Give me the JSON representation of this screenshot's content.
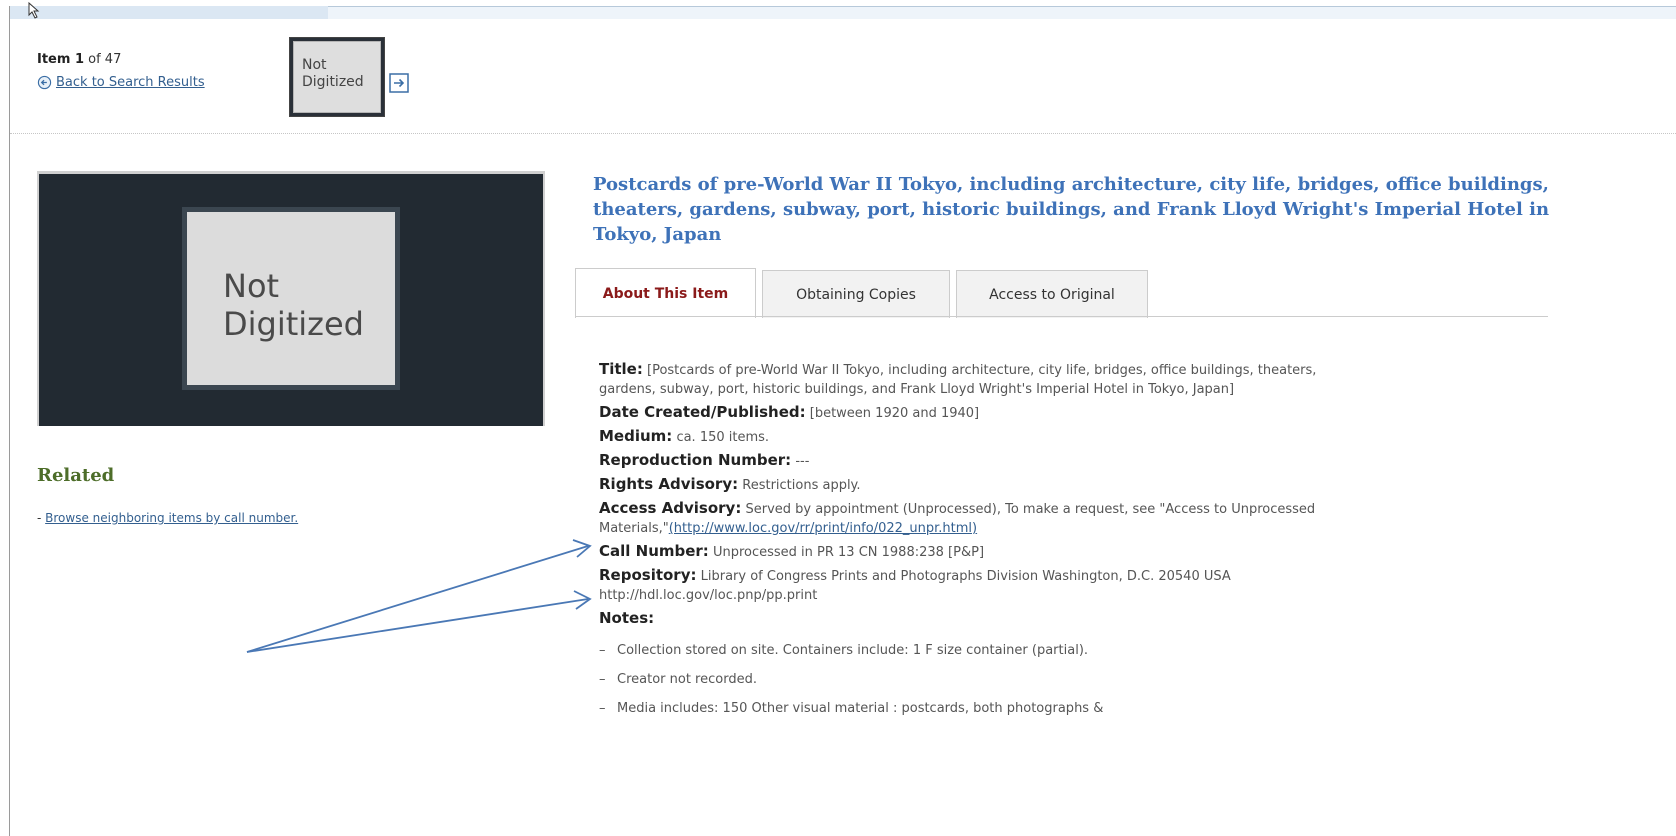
{
  "nav": {
    "item_label": "Item 1",
    "item_of": " of 47",
    "back_label": "Back to Search Results",
    "thumb_line1": "Not",
    "thumb_line2": "Digitized"
  },
  "image_placeholder": {
    "line1": "Not",
    "line2": "Digitized"
  },
  "related": {
    "heading": "Related",
    "prefix": "- ",
    "link": "Browse neighboring items by call number."
  },
  "record": {
    "title": "Postcards of pre-World War II Tokyo, including architecture, city life, bridges, office buildings, theaters, gardens, subway, port, historic buildings, and Frank Lloyd Wright's Imperial Hotel in Tokyo, Japan"
  },
  "tabs": [
    {
      "label": "About This Item"
    },
    {
      "label": "Obtaining Copies"
    },
    {
      "label": "Access to Original"
    }
  ],
  "fields": {
    "title": {
      "label": "Title:",
      "value": "[Postcards of pre-World War II Tokyo, including architecture, city life, bridges, office buildings, theaters, gardens, subway, port, historic buildings, and Frank Lloyd Wright's Imperial Hotel in Tokyo, Japan]"
    },
    "date": {
      "label": "Date Created/Published:",
      "value": "[between 1920 and 1940]"
    },
    "medium": {
      "label": "Medium:",
      "value": "ca. 150 items."
    },
    "repro": {
      "label": "Reproduction Number:",
      "value": "---"
    },
    "rights": {
      "label": "Rights Advisory:",
      "value": "Restrictions apply."
    },
    "access": {
      "label": "Access Advisory:",
      "value": "Served by appointment (Unprocessed), To make a request, see \"Access to Unprocessed Materials,\"",
      "link": "(http://www.loc.gov/rr/print/info/022_unpr.html)"
    },
    "call": {
      "label": "Call Number:",
      "value": "Unprocessed in PR 13 CN 1988:238 [P&P]"
    },
    "repository": {
      "label": "Repository:",
      "value": "Library of Congress Prints and Photographs Division Washington, D.C. 20540 USA http://hdl.loc.gov/loc.pnp/pp.print"
    },
    "notes": {
      "label": "Notes:"
    }
  },
  "notes": [
    "Collection stored on site. Containers include: 1 F size container (partial).",
    "Creator not recorded.",
    "Media includes: 150 Other visual material : postcards, both photographs &"
  ],
  "colors": {
    "title_blue": "#3e72b8",
    "related_green": "#4d6d29",
    "active_tab": "#8b1a1a",
    "arrow": "#4a78b5"
  }
}
